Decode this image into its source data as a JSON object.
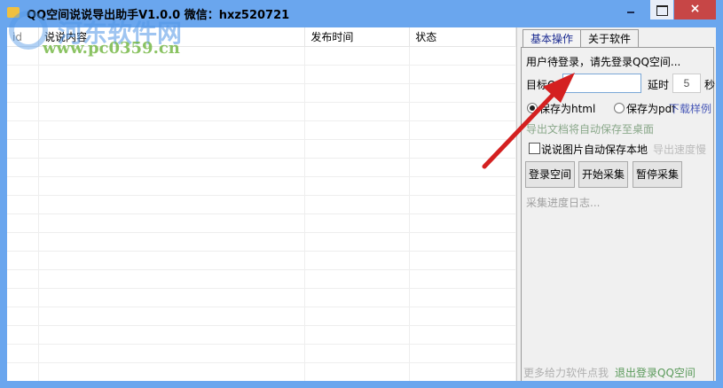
{
  "window": {
    "title": "QQ空间说说导出助手V1.0.0  微信：hxz520721",
    "close": "×"
  },
  "watermark": {
    "line1": "河东软件网",
    "line2": "www.pc0359.cn"
  },
  "table": {
    "columns": [
      "id",
      "说说内容",
      "发布时间",
      "状态"
    ],
    "rows": 18
  },
  "panel": {
    "tabs": [
      "基本操作",
      "关于软件"
    ],
    "status": "用户待登录，请先登录QQ空间...",
    "target_label": "目标QQ",
    "target_value": "",
    "delay_label": "延时",
    "delay_value": "5",
    "delay_unit": "秒",
    "radio_html": "保存为html",
    "radio_pdf": "保存为pdf",
    "download_sample": "下载样例",
    "save_note": "导出文档将自动保存至桌面",
    "save_images": "说说图片自动保存本地",
    "slow_note": "导出速度慢",
    "buttons": [
      "登录空间",
      "开始采集",
      "暂停采集"
    ],
    "log": "采集进度日志...",
    "more_link": "更多给力软件点我",
    "logout_link": "退出登录QQ空间"
  },
  "colors": {
    "frame": "#6aa6ee",
    "close": "#c74646",
    "arrow": "#d42020"
  }
}
